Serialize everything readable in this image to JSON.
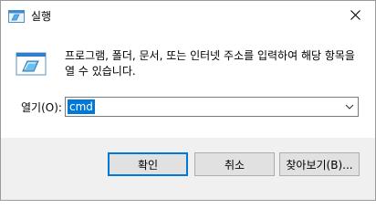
{
  "window": {
    "title": "실행",
    "accent_color": "#0078d7",
    "title_icon": "run-dialog-icon",
    "close_icon": "close-icon"
  },
  "content": {
    "icon": "run-icon",
    "description": "프로그램, 폴더, 문서, 또는 인터넷 주소를 입력하여 해당 항목을 열 수 있습니다.",
    "open_label": "열기(O):",
    "open_value": "cmd"
  },
  "buttons": {
    "ok": "확인",
    "cancel": "취소",
    "browse": "찾아보기(B)..."
  }
}
